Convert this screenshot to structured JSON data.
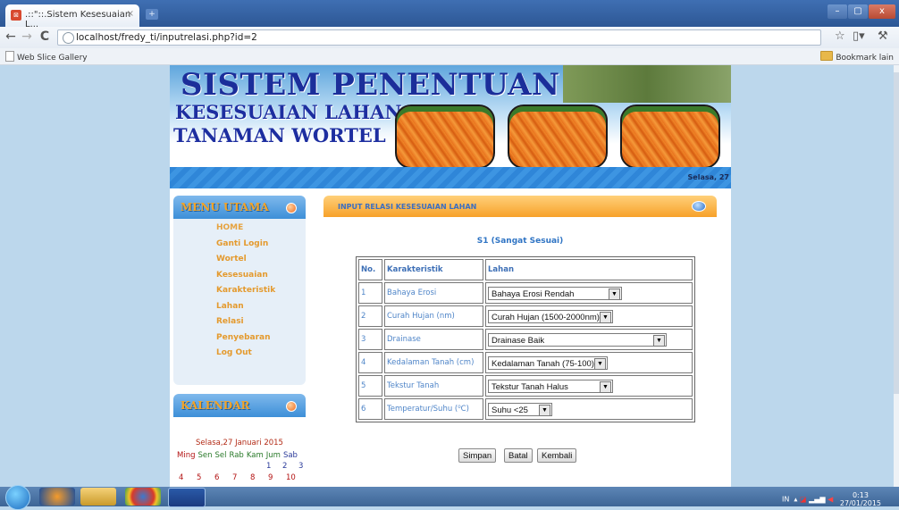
{
  "browser": {
    "tab_title": ".::\"::.Sistem Kesesuaian L...",
    "tab_close": "×",
    "new_tab": "+",
    "url": "localhost/fredy_ti/inputrelasi.php?id=2",
    "bookmarks_left": "Web Slice Gallery",
    "bookmarks_right": "Bookmark lain",
    "win_min": "–",
    "win_max": "▢",
    "win_close": "x"
  },
  "banner": {
    "title_line1": "SISTEM PENENTUAN",
    "title_line2": "KESESUAIAN LAHAN",
    "title_line3": "TANAMAN WORTEL",
    "date": "Selasa, 27"
  },
  "menu": {
    "title": "MENU UTAMA",
    "items": [
      "HOME",
      "Ganti Login",
      "Wortel",
      "Kesesuaian",
      "Karakteristik",
      "Lahan",
      "Relasi",
      "Penyebaran",
      "Log Out"
    ]
  },
  "calendar": {
    "title": "KALENDAR",
    "today": "Selasa,27 Januari 2015",
    "days": [
      "Ming",
      "Sen",
      "Sel",
      "Rab",
      "Kam",
      "Jum",
      "Sab"
    ],
    "row1": [
      "1",
      "2",
      "3"
    ],
    "row2": [
      "4",
      "5",
      "6",
      "7",
      "8",
      "9",
      "10"
    ]
  },
  "main": {
    "header": "INPUT RELASI KESESUAIAN LAHAN",
    "subtitle": "S1 (Sangat Sesuai)",
    "table": {
      "headers": [
        "No.",
        "Karakteristik",
        "Lahan"
      ],
      "rows": [
        {
          "no": "1",
          "karakteristik": "Bahaya Erosi",
          "lahan": "Bahaya Erosi Rendah"
        },
        {
          "no": "2",
          "karakteristik": "Curah Hujan (nm)",
          "lahan": "Curah Hujan (1500-2000nm)"
        },
        {
          "no": "3",
          "karakteristik": "Drainase",
          "lahan": "Drainase Baik"
        },
        {
          "no": "4",
          "karakteristik": "Kedalaman Tanah (cm)",
          "lahan": "Kedalaman Tanah (75-100)"
        },
        {
          "no": "5",
          "karakteristik": "Tekstur Tanah",
          "lahan": "Tekstur Tanah Halus"
        },
        {
          "no": "6",
          "karakteristik": "Temperatur/Suhu (⁰C)",
          "lahan": "Suhu <25"
        }
      ]
    },
    "buttons": {
      "save": "Simpan",
      "cancel": "Batal",
      "back": "Kembali"
    }
  },
  "taskbar": {
    "lang": "IN",
    "time": "0:13",
    "date": "27/01/2015"
  },
  "colors": {
    "page_bg": "#bcd7ec",
    "title_blue": "#1b2e9a",
    "menu_orange": "#e49a2e",
    "header_orange": "#f7a12a"
  }
}
